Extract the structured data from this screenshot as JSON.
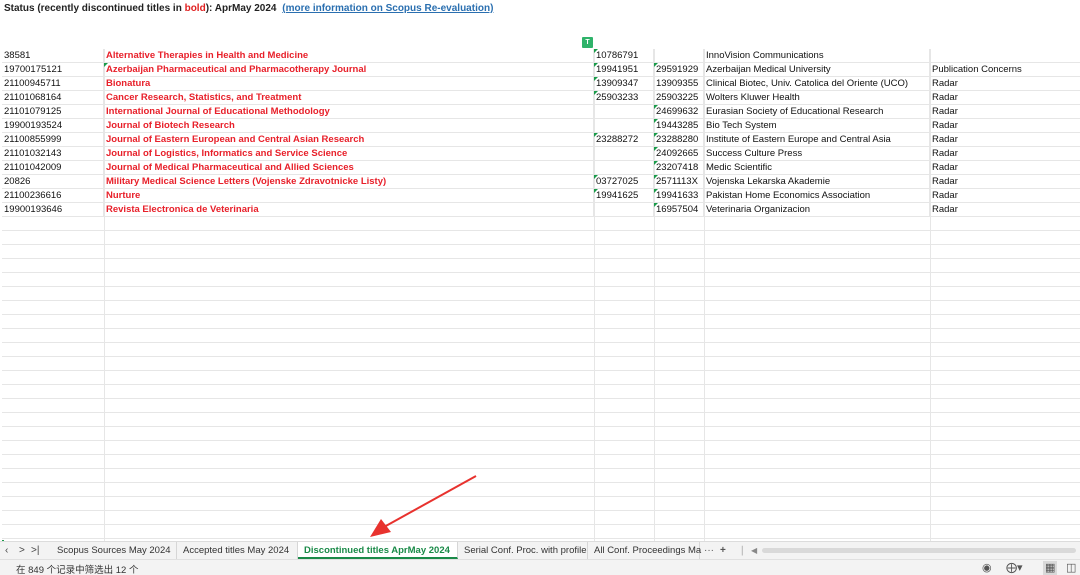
{
  "status": {
    "prefix": "Status (recently discontinued titles in ",
    "bold_word": "bold",
    "suffix": "): AprMay 2024",
    "link": "(more information on Scopus Re-evaluation)"
  },
  "filter_icon_label": "T",
  "rows": [
    {
      "id": "38581",
      "title": "Alternative Therapies in Health and Medicine",
      "issn": "10786791",
      "eissn": "",
      "publisher": "InnoVision Communications",
      "status": ""
    },
    {
      "id": "19700175121",
      "title": "Azerbaijan Pharmaceutical and Pharmacotherapy Journal",
      "issn": "19941951",
      "eissn": "29591929",
      "publisher": "Azerbaijan Medical University",
      "status": "Publication Concerns"
    },
    {
      "id": "21100945711",
      "title": "Bionatura",
      "issn": "13909347",
      "eissn": "13909355",
      "publisher": "Clinical Biotec, Univ. Catolica del Oriente (UCO)",
      "status": "Radar"
    },
    {
      "id": "21101068164",
      "title": "Cancer Research, Statistics, and Treatment",
      "issn": "25903233",
      "eissn": "25903225",
      "publisher": "Wolters Kluwer Health",
      "status": "Radar"
    },
    {
      "id": "21101079125",
      "title": "International Journal of Educational Methodology",
      "issn": "",
      "eissn": "24699632",
      "publisher": "Eurasian Society of Educational Research",
      "status": "Radar"
    },
    {
      "id": "19900193524",
      "title": "Journal of Biotech Research",
      "issn": "",
      "eissn": "19443285",
      "publisher": "Bio Tech System",
      "status": "Radar"
    },
    {
      "id": "21100855999",
      "title": "Journal of Eastern European and Central Asian Research",
      "issn": "23288272",
      "eissn": "23288280",
      "publisher": "Institute of Eastern Europe and Central Asia",
      "status": "Radar"
    },
    {
      "id": "21101032143",
      "title": "Journal of Logistics, Informatics and Service Science",
      "issn": "",
      "eissn": "24092665",
      "publisher": "Success Culture Press",
      "status": "Radar"
    },
    {
      "id": "21101042009",
      "title": "Journal of Medical Pharmaceutical and Allied Sciences",
      "issn": "",
      "eissn": "23207418",
      "publisher": "Medic Scientific",
      "status": "Radar"
    },
    {
      "id": "20826",
      "title": "Military Medical Science Letters (Vojenske Zdravotnicke Listy)",
      "issn": "03727025",
      "eissn": "2571113X",
      "publisher": "Vojenska Lekarska Akademie",
      "status": "Radar"
    },
    {
      "id": "21100236616",
      "title": "Nurture",
      "issn": "19941625",
      "eissn": "19941633",
      "publisher": "Pakistan Home Economics Association",
      "status": "Radar"
    },
    {
      "id": "19900193646",
      "title": "Revista Electronica de Veterinaria",
      "issn": "",
      "eissn": "16957504",
      "publisher": "Veterinaria Organizacion",
      "status": "Radar"
    }
  ],
  "tabs": [
    {
      "label": "Scopus Sources May 2024",
      "active": false
    },
    {
      "label": "Accepted titles May 2024",
      "active": false
    },
    {
      "label": "Discontinued titles AprMay 2024",
      "active": true
    },
    {
      "label": "Serial Conf. Proc. with profile",
      "active": false
    },
    {
      "label": "All Conf. Proceedings Ma",
      "active": false
    }
  ],
  "nav": {
    "prev": "<",
    "next": ">",
    "last": ">|"
  },
  "tab_more": "···",
  "tab_add": "+",
  "statusbar": {
    "message": "在 849 个记录中筛选出 12 个"
  },
  "colors": {
    "accent": "#1a8a48",
    "bold_title": "#e8202a",
    "link": "#2a6fb0",
    "arrow": "#e8322e"
  }
}
